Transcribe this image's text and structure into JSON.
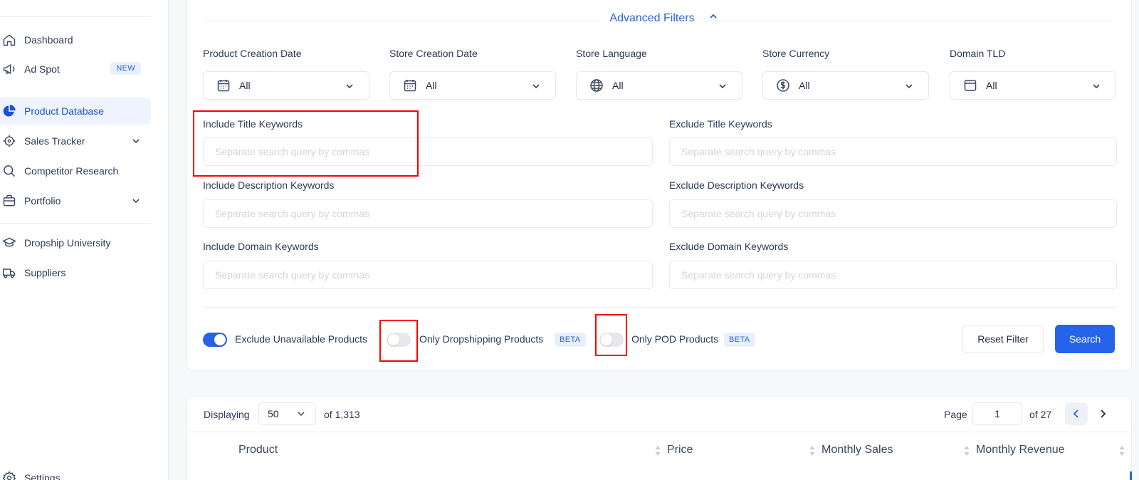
{
  "sidebar": {
    "items": [
      {
        "label": "Dashboard",
        "icon": "home-icon"
      },
      {
        "label": "Ad Spot",
        "icon": "megaphone-icon",
        "badge": "NEW"
      },
      {
        "label": "Product Database",
        "icon": "pie-chart-icon",
        "active": true
      },
      {
        "label": "Sales Tracker",
        "icon": "target-icon",
        "expandable": true
      },
      {
        "label": "Competitor Research",
        "icon": "search-icon"
      },
      {
        "label": "Portfolio",
        "icon": "briefcase-icon",
        "expandable": true
      },
      {
        "label": "Dropship University",
        "icon": "graduation-cap-icon"
      },
      {
        "label": "Suppliers",
        "icon": "truck-icon"
      },
      {
        "label": "Settings",
        "icon": "gear-icon"
      }
    ]
  },
  "filters": {
    "advanced_label": "Advanced Filters",
    "selects": [
      {
        "label": "Product Creation Date",
        "value": "All",
        "icon": "calendar-icon"
      },
      {
        "label": "Store Creation Date",
        "value": "All",
        "icon": "calendar-icon"
      },
      {
        "label": "Store Language",
        "value": "All",
        "icon": "globe-icon"
      },
      {
        "label": "Store Currency",
        "value": "All",
        "icon": "dollar-icon"
      },
      {
        "label": "Domain TLD",
        "value": "All",
        "icon": "browser-window-icon"
      }
    ],
    "keywords": {
      "include_title": "Include Title Keywords",
      "exclude_title": "Exclude Title Keywords",
      "include_description": "Include Description Keywords",
      "exclude_description": "Exclude Description Keywords",
      "include_domain": "Include Domain Keywords",
      "exclude_domain": "Exclude Domain Keywords",
      "placeholder": "Separate search query by commas"
    },
    "toggles": {
      "exclude_unavailable": {
        "label": "Exclude Unavailable Products",
        "on": true
      },
      "only_dropshipping": {
        "label": "Only Dropshipping Products",
        "badge": "BETA",
        "on": false
      },
      "only_pod": {
        "label": "Only POD Products",
        "badge": "BETA",
        "on": false
      }
    },
    "reset_label": "Reset Filter",
    "search_label": "Search"
  },
  "results": {
    "displaying_label": "Displaying",
    "per_page": "50",
    "total_label": "of 1,313",
    "page_label": "Page",
    "page_value": "1",
    "page_total": "of 27",
    "columns": [
      "Product",
      "Price",
      "Monthly Sales",
      "Monthly Revenue"
    ]
  },
  "colors": {
    "accent": "#2563eb",
    "highlight_box": "#ff0000"
  }
}
